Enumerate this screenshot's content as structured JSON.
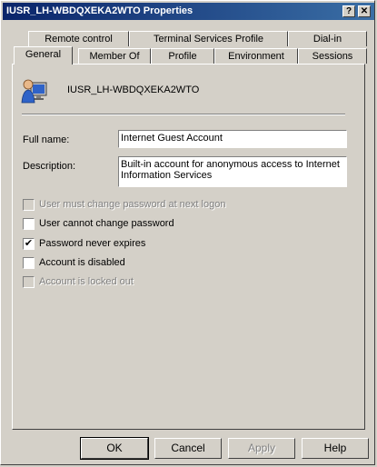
{
  "window": {
    "title": "IUSR_LH-WBDQXEKA2WTO Properties",
    "help_glyph": "?",
    "close_glyph": "✕"
  },
  "tabs_back": [
    {
      "label": "Remote control"
    },
    {
      "label": "Terminal Services Profile"
    },
    {
      "label": "Dial-in"
    }
  ],
  "tabs_front": [
    {
      "label": "General",
      "active": true
    },
    {
      "label": "Member Of"
    },
    {
      "label": "Profile"
    },
    {
      "label": "Environment"
    },
    {
      "label": "Sessions"
    }
  ],
  "general": {
    "account_name": "IUSR_LH-WBDQXEKA2WTO",
    "account_icon": "user-monitor-icon",
    "full_name_label": "Full name:",
    "full_name_value": "Internet Guest Account",
    "description_label": "Description:",
    "description_line1": "Built-in account for anonymous access to Internet",
    "description_line2": "Information Services",
    "options": [
      {
        "label": "User must change password at next logon",
        "checked": false,
        "enabled": false
      },
      {
        "label": "User cannot change password",
        "checked": false,
        "enabled": true
      },
      {
        "label": "Password never expires",
        "checked": true,
        "enabled": true
      },
      {
        "label": "Account is disabled",
        "checked": false,
        "enabled": true
      },
      {
        "label": "Account is locked out",
        "checked": false,
        "enabled": false
      }
    ]
  },
  "buttons": {
    "ok": "OK",
    "cancel": "Cancel",
    "apply": "Apply",
    "help": "Help"
  },
  "colors": {
    "titlebar_start": "#0a246a",
    "titlebar_end": "#3a6ea5",
    "face": "#d4d0c8"
  }
}
